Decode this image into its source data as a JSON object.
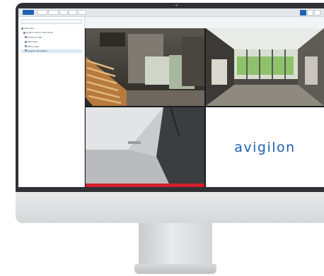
{
  "toolbar": {
    "tabs": [
      {
        "label": "",
        "active": true
      },
      {
        "label": "",
        "active": false
      },
      {
        "label": "",
        "active": false
      },
      {
        "label": "",
        "active": false
      },
      {
        "label": "",
        "active": false
      },
      {
        "label": "",
        "active": false
      }
    ]
  },
  "sidebar": {
    "search_placeholder": "",
    "tree": [
      {
        "label": "Site View",
        "selected": false
      },
      {
        "label": "Avigilon Demo Site North",
        "selected": false
      },
      {
        "label": "Entrance Hall",
        "selected": false
      },
      {
        "label": "Staircase",
        "selected": false
      },
      {
        "label": "Office East",
        "selected": false
      },
      {
        "label": "Avigilon Reception",
        "selected": true
      }
    ]
  },
  "cameras": [
    {
      "id": "camera-staircase",
      "label": "",
      "status": "normal"
    },
    {
      "id": "camera-lobby",
      "label": "",
      "status": "normal"
    },
    {
      "id": "camera-corridor",
      "label": "",
      "status": "alarm"
    }
  ],
  "brand": {
    "logo_text": "avigilon",
    "color": "#1d5fb1"
  },
  "colors": {
    "accent": "#1e63b4",
    "alarm": "#d2202f",
    "bezel": "#2f3134"
  }
}
